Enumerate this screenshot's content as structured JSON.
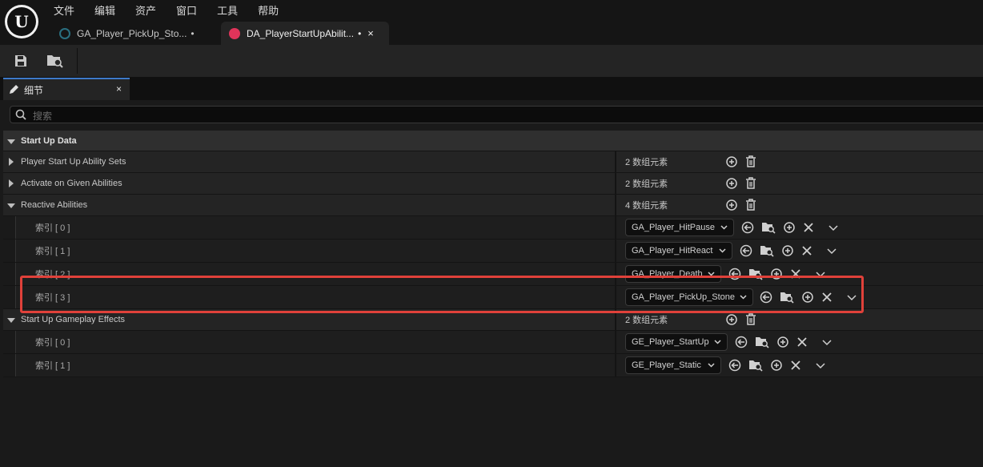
{
  "app": {
    "logo_text": "U",
    "menu": [
      "文件",
      "编辑",
      "资产",
      "窗口",
      "工具",
      "帮助"
    ]
  },
  "tabs": [
    {
      "label": "GA_Player_PickUp_Sto...",
      "modified": "•",
      "icon": "blueprint-icon",
      "active": false
    },
    {
      "label": "DA_PlayerStartUpAbilit...",
      "modified": "•",
      "close": "×",
      "icon": "data-asset-icon",
      "active": true
    }
  ],
  "toolbar": {
    "save_icon": "save-icon",
    "browse_icon": "browse-folder-icon"
  },
  "details_panel": {
    "tab_label": "细节",
    "tab_close": "×",
    "search_placeholder": "搜索",
    "section_title": "Start Up Data",
    "properties": [
      {
        "name": "Player Start Up Ability Sets",
        "value": "2 数组元素",
        "expanded": false
      },
      {
        "name": "Activate on Given Abilities",
        "value": "2 数组元素",
        "expanded": false
      },
      {
        "name": "Reactive Abilities",
        "value": "4 数组元素",
        "expanded": true
      },
      {
        "name": "Start Up Gameplay Effects",
        "value": "2 数组元素",
        "expanded": true
      }
    ],
    "reactive_items": [
      {
        "index": "索引 [ 0 ]",
        "value": "GA_Player_HitPause"
      },
      {
        "index": "索引 [ 1 ]",
        "value": "GA_Player_HitReact"
      },
      {
        "index": "索引 [ 2 ]",
        "value": "GA_Player_Death"
      },
      {
        "index": "索引 [ 3 ]",
        "value": "GA_Player_PickUp_Stone"
      }
    ],
    "effect_items": [
      {
        "index": "索引 [ 0 ]",
        "value": "GE_Player_StartUp"
      },
      {
        "index": "索引 [ 1 ]",
        "value": "GE_Player_Static"
      }
    ]
  },
  "colors": {
    "highlight": "#e0413a",
    "active_tab_accent": "#3d79c8",
    "data_asset_icon": "#e0345a"
  }
}
